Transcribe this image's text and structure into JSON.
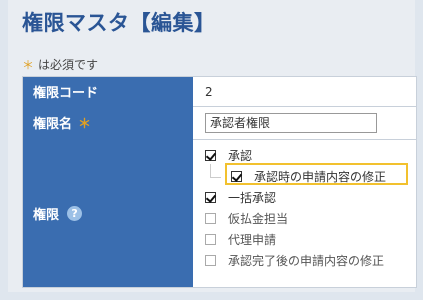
{
  "page": {
    "title": "権限マスタ【編集】",
    "required_star": "＊",
    "required_note": "は必須です"
  },
  "form": {
    "code_label": "権限コード",
    "code_value": "2",
    "name_label": "権限名",
    "name_required": "＊",
    "name_value": "承認者権限",
    "permission_label": "権限",
    "help_icon_glyph": "?"
  },
  "permissions": [
    {
      "label": "承認",
      "checked": true
    },
    {
      "label": "承認時の申請内容の修正",
      "checked": true
    },
    {
      "label": "一括承認",
      "checked": true
    },
    {
      "label": "仮払金担当",
      "checked": false
    },
    {
      "label": "代理申請",
      "checked": false
    },
    {
      "label": "承認完了後の申請内容の修正",
      "checked": false
    }
  ],
  "colors": {
    "header_bg": "#3a6db0",
    "title": "#2a5595",
    "required_star": "#e0a023",
    "highlight_border": "#f2c12e"
  }
}
